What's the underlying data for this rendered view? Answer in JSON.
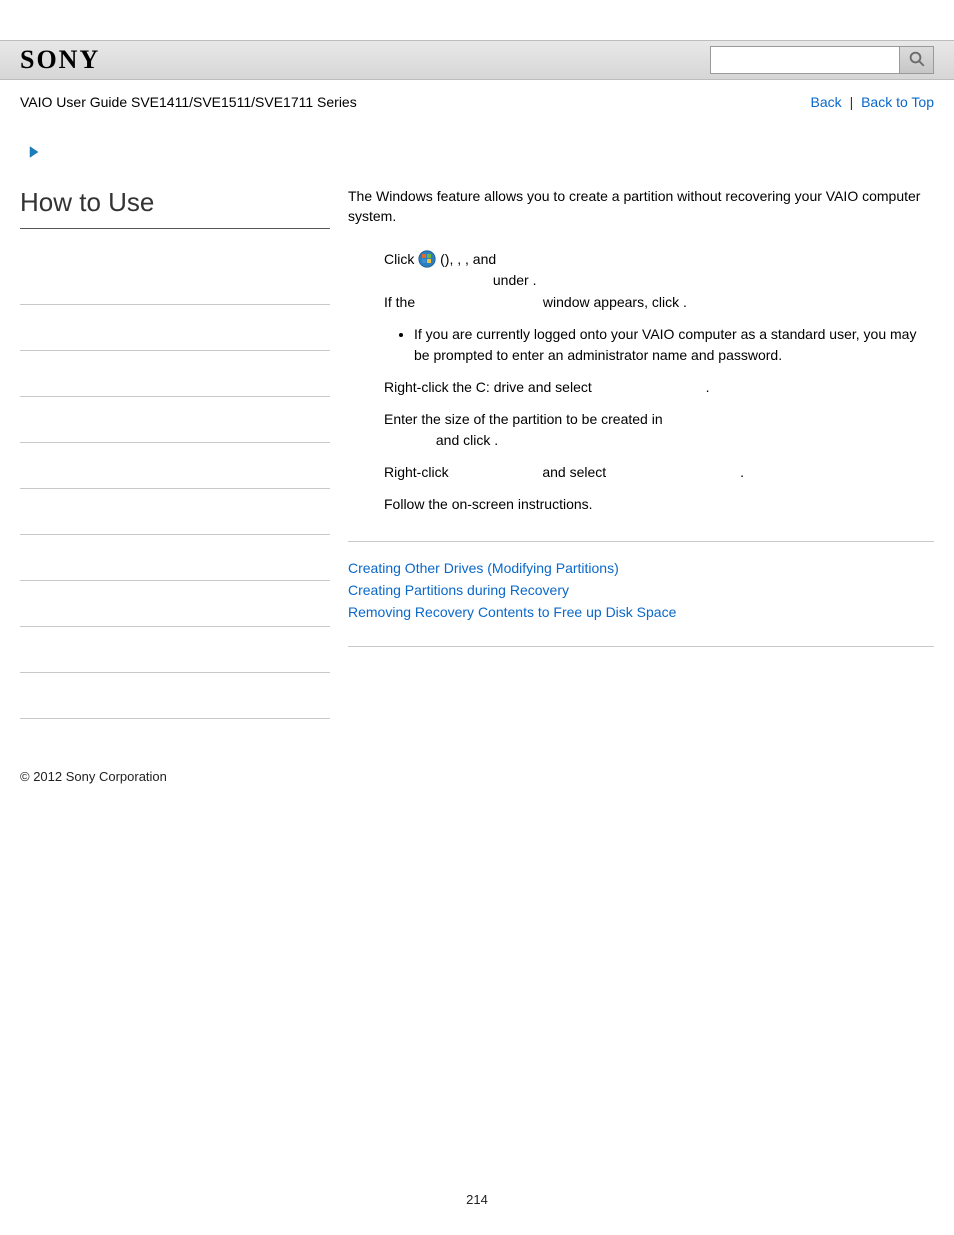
{
  "header": {
    "logo_text": "SONY",
    "search": {
      "value": "",
      "placeholder": ""
    }
  },
  "toprow": {
    "breadcrumb": "VAIO User Guide SVE1411/SVE1511/SVE1711 Series",
    "back": "Back",
    "back_to_top": "Back to Top",
    "separator": "|"
  },
  "left": {
    "title": "How to Use",
    "items": [
      "",
      "",
      "",
      "",
      "",
      "",
      "",
      "",
      "",
      ""
    ]
  },
  "main": {
    "intro": "The Windows feature allows you to create a partition without recovering your VAIO computer system.",
    "step1": {
      "t1": "Click ",
      "t2": " (",
      "t3": "), ",
      "t4": ", ",
      "t5": ", and ",
      "t6": " under ",
      "t7": "."
    },
    "step1b": {
      "t1": "If the ",
      "t2": " window appears, click ",
      "t3": "."
    },
    "bullet1": "If you are currently logged onto your VAIO computer as a standard user, you may be prompted to enter an administrator name and password.",
    "step2": {
      "t1": "Right-click the C: drive and select ",
      "t2": "."
    },
    "step3": {
      "t1": "Enter the size of the partition to be created in ",
      "t2": " and click ",
      "t3": "."
    },
    "step4": {
      "t1": "Right-click ",
      "t2": " and select ",
      "t3": "."
    },
    "step5": "Follow the on-screen instructions.",
    "related": [
      "Creating Other Drives (Modifying Partitions)",
      "Creating Partitions during Recovery",
      "Removing Recovery Contents to Free up Disk Space"
    ]
  },
  "footer": {
    "copyright": "© 2012 Sony Corporation",
    "page_number": "214"
  }
}
